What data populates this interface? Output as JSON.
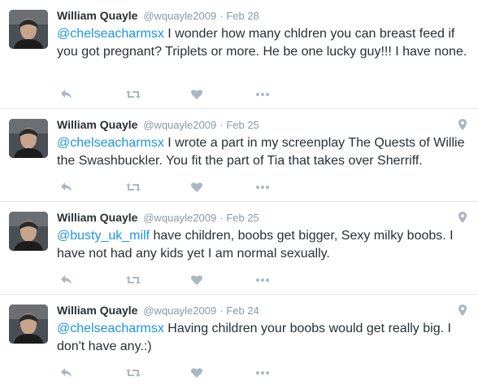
{
  "colors": {
    "link": "#1b95e0",
    "meta": "#8899a6",
    "text": "#292f33",
    "icon": "#aab8c2",
    "divider": "#e1e8ed"
  },
  "tweets": [
    {
      "fullname": "William Quayle",
      "username": "@wquayle2009",
      "separator": "·",
      "time": "Feb 28",
      "mention": "@chelseacharmsx",
      "body": " I wonder how many chldren you can breast feed if you got pregnant? Triplets or more.  He be one lucky guy!!! I have none.",
      "has_geo": false
    },
    {
      "fullname": "William Quayle",
      "username": "@wquayle2009",
      "separator": "·",
      "time": "Feb 25",
      "mention": "@chelseacharmsx",
      "body": " I wrote a part in my screenplay The Quests of Willie the Swashbuckler.  You fit the part of Tia that takes over Sherriff.",
      "has_geo": true
    },
    {
      "fullname": "William Quayle",
      "username": "@wquayle2009",
      "separator": "·",
      "time": "Feb 25",
      "mention": "@busty_uk_milf",
      "body": " have children,  boobs get bigger,  Sexy milky boobs.  I have not had any kids yet I am normal sexually.",
      "has_geo": true
    },
    {
      "fullname": "William Quayle",
      "username": "@wquayle2009",
      "separator": "·",
      "time": "Feb 24",
      "mention": "@chelseacharmsx",
      "body": " Having children your boobs would get really big.  I don't have any.:)",
      "has_geo": true
    }
  ],
  "action_icons": [
    "reply-icon",
    "retweet-icon",
    "like-icon",
    "more-icon"
  ]
}
